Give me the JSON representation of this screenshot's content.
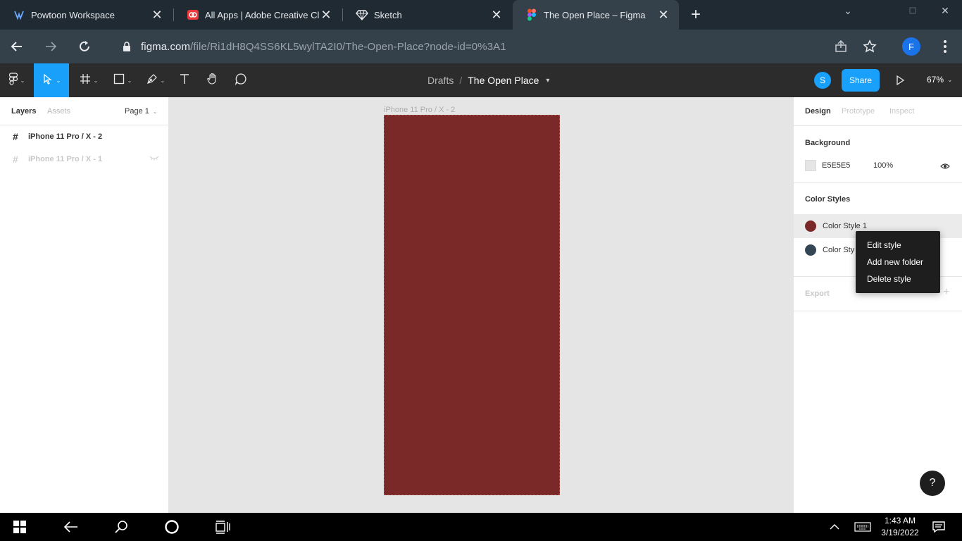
{
  "browser": {
    "tabs": [
      {
        "title": "Powtoon Workspace",
        "icon": "powtoon-icon",
        "active": false
      },
      {
        "title": "All Apps | Adobe Creative Clou",
        "icon": "adobe-cc-icon",
        "active": false
      },
      {
        "title": "Sketch",
        "icon": "sketch-diamond-icon",
        "active": false
      },
      {
        "title": "The Open Place – Figma",
        "icon": "figma-icon",
        "active": true
      }
    ],
    "url_host": "figma.com",
    "url_path": "/file/Ri1dH8Q4SS6KL5wylTA2I0/The-Open-Place?node-id=0%3A1",
    "profile_initial": "F"
  },
  "figma": {
    "breadcrumb": {
      "parent": "Drafts",
      "separator": "/",
      "file": "The Open Place"
    },
    "collaborator_initial": "S",
    "share_label": "Share",
    "zoom": "67%",
    "left_panel": {
      "tab_layers": "Layers",
      "tab_assets": "Assets",
      "page": "Page 1",
      "layers": [
        {
          "name": "iPhone 11 Pro / X - 2",
          "hidden": false
        },
        {
          "name": "iPhone 11 Pro / X - 1",
          "hidden": true
        }
      ]
    },
    "canvas": {
      "frame_label": "iPhone 11 Pro / X - 2",
      "frame_color": "#7b2829"
    },
    "right_panel": {
      "tab_design": "Design",
      "tab_prototype": "Prototype",
      "tab_inspect": "Inspect",
      "background_title": "Background",
      "background_hex": "E5E5E5",
      "background_opacity": "100%",
      "color_styles_title": "Color Styles",
      "color_styles": [
        {
          "name": "Color Style 1",
          "color": "#7b2829"
        },
        {
          "name": "Color Sty",
          "color": "#344654"
        }
      ],
      "export_title": "Export"
    },
    "context_menu": [
      "Edit style",
      "Add new folder",
      "Delete style"
    ],
    "help_label": "?"
  },
  "taskbar": {
    "time": "1:43 AM",
    "date": "3/19/2022"
  }
}
